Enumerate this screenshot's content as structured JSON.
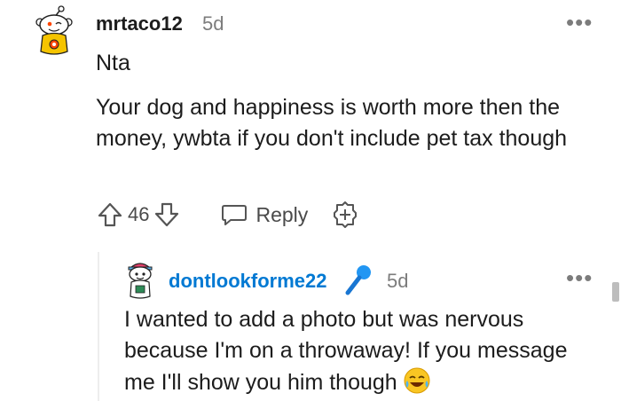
{
  "comment": {
    "username": "mrtaco12",
    "age": "5d",
    "more_label": "•••",
    "body_first": "Nta",
    "body_second": "Your dog and happiness is worth more then the money, ywbta if you don't include pet tax though",
    "score": "46",
    "reply_label": "Reply"
  },
  "reply": {
    "username": "dontlookforme22",
    "age": "5d",
    "more_label": "•••",
    "body": "I wanted to add a photo but was nervous because I'm on a throwaway! If you message me I'll show you him though"
  },
  "icons": {
    "upvote": "upvote-arrow-icon",
    "downvote": "downvote-arrow-icon",
    "reply": "speech-bubble-icon",
    "award": "award-plus-icon",
    "flair": "microphone-icon",
    "emoji": "laughing-tears-emoji"
  },
  "colors": {
    "username_link": "#0079d3",
    "muted": "#7c7c7c",
    "text": "#1c1c1c"
  }
}
